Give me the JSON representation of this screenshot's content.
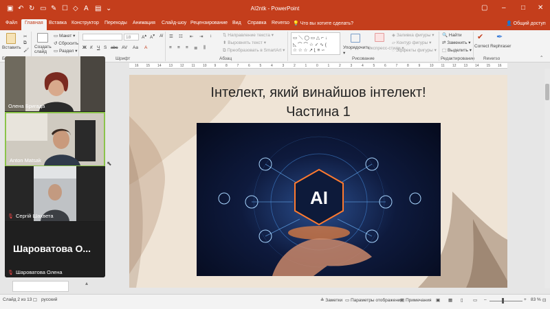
{
  "window": {
    "title": "AI2ntk  -  PowerPoint",
    "share_label": "Общий доступ",
    "search_placeholder": "Что вы хотите сделать?"
  },
  "tabs": [
    "Файл",
    "Главная",
    "Вставка",
    "Конструктор",
    "Переходы",
    "Анимация",
    "Слайд-шоу",
    "Рецензирование",
    "Вид",
    "Справка",
    "Reverso"
  ],
  "ribbon": {
    "paste": "Вставить",
    "new_slide": "Создать слайд",
    "layout": "Макет",
    "reset": "Сбросить",
    "section": "Раздел",
    "font_size": "18",
    "text_direction": "Направление текста",
    "align_text": "Выровнять текст",
    "smartart": "Преобразовать в SmartArt",
    "arrange": "Упорядочить",
    "quick_styles": "Экспресс-стили",
    "shape_fill": "Заливка фигуры",
    "shape_outline": "Контур фигуры",
    "shape_effects": "Эффекты фигуры",
    "find": "Найти",
    "replace": "Заменить",
    "select": "Выделить",
    "correct_rephraser": "Correct Rephraser",
    "groups": {
      "font": "Шрифт",
      "paragraph": "Абзац",
      "drawing": "Рисование",
      "editing": "Редактирование",
      "reverso": "Reverso"
    }
  },
  "ruler_numbers": [
    "16",
    "15",
    "14",
    "13",
    "12",
    "11",
    "10",
    "9",
    "8",
    "7",
    "6",
    "5",
    "4",
    "3",
    "2",
    "1",
    "0",
    "1",
    "2",
    "3",
    "4",
    "5",
    "6",
    "7",
    "8",
    "9",
    "10",
    "11",
    "12",
    "13",
    "14",
    "15",
    "16"
  ],
  "slide": {
    "title_line1": "Інтелект, який винайшов інтелект!",
    "title_line2": "Частина 1",
    "image_text": "AI"
  },
  "participants": [
    {
      "name": "Олена Бригада",
      "muted": false,
      "video": true
    },
    {
      "name": "Anton Matsak",
      "muted": false,
      "video": true
    },
    {
      "name": "Сергій Шахвета",
      "muted": true,
      "video": true
    },
    {
      "name": "Шароватова Олена",
      "display_text": "Шароватова  О...",
      "muted": true,
      "video": false
    }
  ],
  "statusbar": {
    "slide_info": "Слайд 2 из 13",
    "language": "русский",
    "notes": "Заметки",
    "display_settings": "Параметры отображения",
    "comments": "Примечания",
    "zoom": "83 %"
  },
  "colors": {
    "accent": "#c43e1c",
    "ribbon_bg": "#f3f3f3",
    "slide_bg": "#efe4d6",
    "panel_bg": "#1d1d1d",
    "active_speaker": "#8bc34a"
  }
}
